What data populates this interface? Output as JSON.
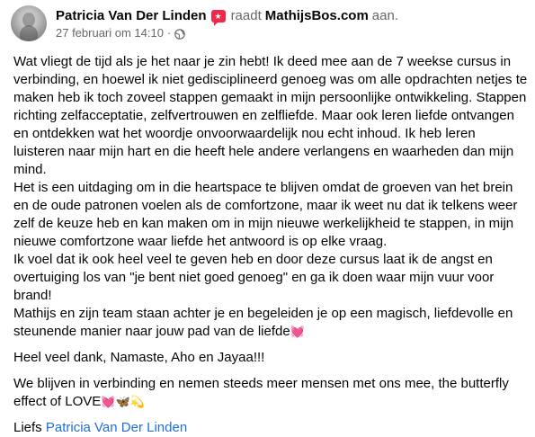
{
  "header": {
    "author": "Patricia Van Der Linden",
    "badge_icon": "recommendation-icon",
    "verb": "raadt",
    "page": "MathijsBos.com",
    "tail": "aan.",
    "timestamp": "27 februari om 14:10",
    "separator": "·",
    "privacy_icon": "globe-icon"
  },
  "body": {
    "paragraphs": [
      "Wat vliegt de tijd als je het naar je zin hebt! Ik deed mee aan de 7 weekse cursus in verbinding, en hoewel ik niet gedisciplineerd genoeg was om alle opdrachten netjes te maken heb ik toch zoveel stappen gemaakt in mijn persoonlijke ontwikkeling. Stappen richting zelfacceptatie, zelfvertrouwen en zelfliefde. Maar ook leren liefde ontvangen en ontdekken wat het woordje onvoorwaardelijk nou echt inhoud. Ik heb leren luisteren naar mijn hart en die heeft hele andere verlangens en waarheden dan mijn mind.",
      "Het is een uitdaging om in die heartspace te blijven omdat de groeven van het brein en de oude patronen voelen als de comfortzone, maar ik weet nu dat ik telkens weer zelf de keuze heb en kan maken om in mijn nieuwe werkelijkheid te stappen, in mijn nieuwe comfortzone waar liefde het antwoord is op elke vraag.",
      "Ik voel dat ik ook heel veel te geven heb en door deze cursus laat ik de angst en overtuiging los van \"je bent niet goed genoeg\" en ga ik doen waar mijn vuur voor brand!",
      "Mathijs en zijn team staan achter je en begeleiden je op een magisch, liefdevolle en steunende manier naar jouw pad van de liefde"
    ],
    "p4_emoji": "💓",
    "thanks": "Heel veel dank, Namaste, Aho en Jayaa!!!",
    "closing": "We blijven in verbinding en nemen steeds meer mensen met ons mee, the butterfly effect of LOVE",
    "closing_emoji": "💓🦋💫",
    "signoff_prefix": "Liefs",
    "signoff_link": "Patricia Van Der Linden"
  }
}
